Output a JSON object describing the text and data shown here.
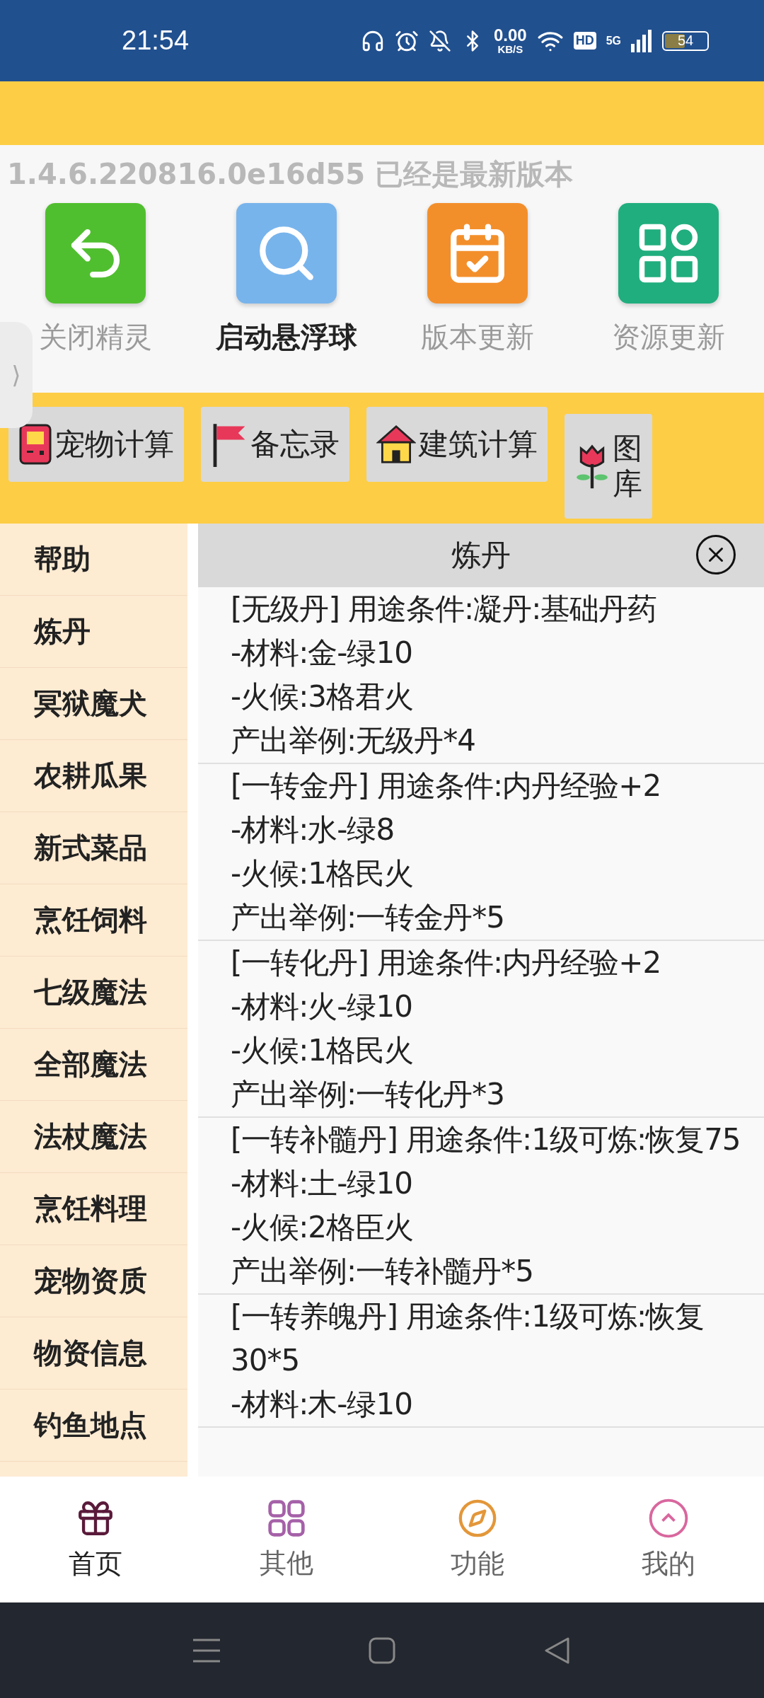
{
  "status_bar": {
    "time": "21:54",
    "speed_value": "0.00",
    "speed_unit": "KB/S",
    "hd": "HD",
    "network": "5G",
    "battery": "54"
  },
  "version_notice": "1.4.6.220816.0e16d55 已经是最新版本",
  "side_handle": "⟩",
  "shortcuts": [
    {
      "kind": "back",
      "label": "关闭精灵",
      "selected": false
    },
    {
      "kind": "search",
      "label": "启动悬浮球",
      "selected": true
    },
    {
      "kind": "calendar",
      "label": "版本更新",
      "selected": false
    },
    {
      "kind": "grid",
      "label": "资源更新",
      "selected": false
    }
  ],
  "tools": [
    {
      "kind": "gameboy",
      "label": "宠物计算"
    },
    {
      "kind": "flag",
      "label": "备忘录"
    },
    {
      "kind": "house",
      "label": "建筑计算"
    },
    {
      "kind": "flower",
      "label": "图库"
    }
  ],
  "sidebar": {
    "items": [
      "帮助",
      "炼丹",
      "冥狱魔犬",
      "农耕瓜果",
      "新式菜品",
      "烹饪饲料",
      "七级魔法",
      "全部魔法",
      "法杖魔法",
      "烹饪料理",
      "宠物资质",
      "物资信息",
      "钓鱼地点"
    ]
  },
  "panel": {
    "title": "炼丹",
    "entries": [
      [
        "[无级丹] 用途条件:凝丹:基础丹药",
        "-材料:金-绿10",
        "-火候:3格君火",
        "产出举例:无级丹*4"
      ],
      [
        "[一转金丹] 用途条件:内丹经验+2",
        "-材料:水-绿8",
        "-火候:1格民火",
        "产出举例:一转金丹*5"
      ],
      [
        "[一转化丹] 用途条件:内丹经验+2",
        "-材料:火-绿10",
        "-火候:1格民火",
        "产出举例:一转化丹*3"
      ],
      [
        "[一转补髓丹] 用途条件:1级可炼:恢复75",
        "-材料:土-绿10",
        "-火候:2格臣火",
        "产出举例:一转补髓丹*5"
      ],
      [
        "[一转养魄丹] 用途条件:1级可炼:恢复30*5",
        "-材料:木-绿10"
      ]
    ]
  },
  "bottom_nav": [
    {
      "kind": "gift",
      "label": "首页",
      "selected": true
    },
    {
      "kind": "grid",
      "label": "其他",
      "selected": false
    },
    {
      "kind": "compass",
      "label": "功能",
      "selected": false
    },
    {
      "kind": "up",
      "label": "我的",
      "selected": false
    }
  ]
}
